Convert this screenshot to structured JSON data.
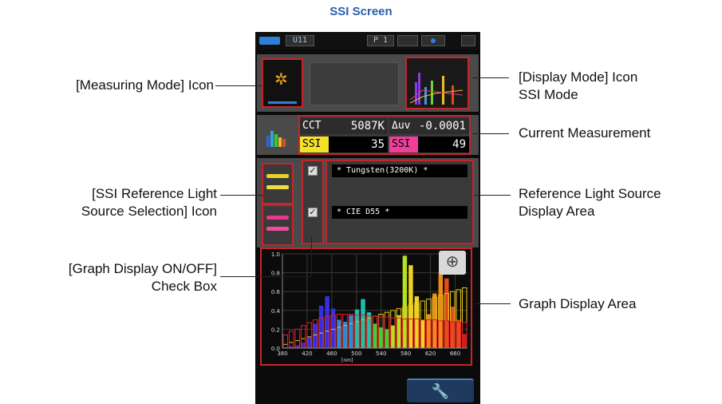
{
  "header": {
    "title": "SSI Screen"
  },
  "annotations": {
    "measuring_mode": "[Measuring Mode] Icon",
    "display_mode_1": "[Display Mode] Icon",
    "display_mode_2": "SSI Mode",
    "current_measurement": "Current Measurement",
    "ref_selection_1": "[SSI Reference Light",
    "ref_selection_2": "Source Selection] Icon",
    "ref_display_1": "Reference Light Source",
    "ref_display_2": "Display Area",
    "graph_onoff_1": "[Graph Display ON/OFF]",
    "graph_onoff_2": "Check Box",
    "graph_area": "Graph Display Area"
  },
  "device": {
    "status_bar": {
      "memory": "U11",
      "page": "P 1"
    },
    "measurement": {
      "cct_label": "CCT",
      "cct_value": "5087K",
      "duv_label": "Δuv",
      "duv_value": "-0.0001",
      "ssi1_label": "SSI",
      "ssi1_value": "35",
      "ssi2_label": "SSI",
      "ssi2_value": "49"
    },
    "references": [
      {
        "name": "* Tungsten(3200K) *",
        "checked": true,
        "color": "#e6c81e"
      },
      {
        "name": "* CIE D55 *",
        "checked": true,
        "color": "#e8398a"
      }
    ]
  },
  "chart_data": {
    "type": "bar",
    "xlabel": "[nm]",
    "x_ticks": [
      "380",
      "420",
      "460",
      "500",
      "540",
      "580",
      "620",
      "660"
    ],
    "y_ticks": [
      "0.0",
      "0.2",
      "0.4",
      "0.6",
      "0.8",
      "1.0"
    ],
    "ylim": [
      0,
      1.0
    ],
    "xlim": [
      380,
      680
    ],
    "series": [
      {
        "values": [
          0.01,
          0.02,
          0.03,
          0.06,
          0.12,
          0.26,
          0.45,
          0.55,
          0.42,
          0.3,
          0.28,
          0.35,
          0.41,
          0.52,
          0.38,
          0.26,
          0.22,
          0.2,
          0.24,
          0.35,
          0.98,
          0.88,
          0.55,
          0.3,
          0.36,
          0.58,
          0.8,
          0.74,
          0.44,
          0.3,
          0.15
        ],
        "colors_range": "spectrum"
      },
      {
        "values": [
          0.04,
          0.06,
          0.08,
          0.1,
          0.12,
          0.14,
          0.16,
          0.18,
          0.2,
          0.22,
          0.24,
          0.26,
          0.28,
          0.3,
          0.32,
          0.34,
          0.36,
          0.38,
          0.4,
          0.42,
          0.44,
          0.46,
          0.48,
          0.5,
          0.52,
          0.54,
          0.56,
          0.58,
          0.6,
          0.62,
          0.64
        ],
        "color": "#e6c81e"
      },
      {
        "values": [
          0.14,
          0.18,
          0.2,
          0.24,
          0.27,
          0.3,
          0.32,
          0.34,
          0.35,
          0.36,
          0.36,
          0.36,
          0.35,
          0.35,
          0.34,
          0.34,
          0.33,
          0.33,
          0.32,
          0.32,
          0.31,
          0.31,
          0.31,
          0.3,
          0.3,
          0.3,
          0.29,
          0.29,
          0.28,
          0.28,
          0.27
        ],
        "color": "#e0202a"
      }
    ]
  }
}
